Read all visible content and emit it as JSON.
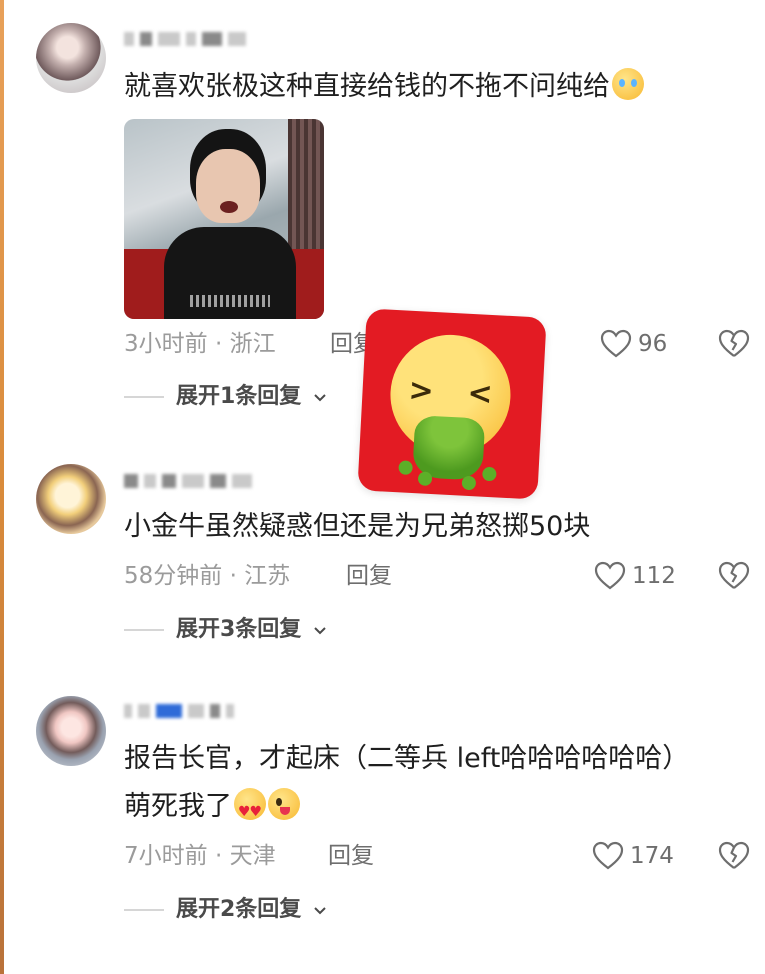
{
  "comments": [
    {
      "text": "就喜欢张极这种直接给钱的不拖不问纯给",
      "emoji": "crying-face",
      "has_photo": true,
      "meta": "3小时前 · 浙江",
      "reply_label": "回复",
      "likes": "96",
      "expand_label": "展开1条回复"
    },
    {
      "text": "小金牛虽然疑惑但还是为兄弟怒掷50块",
      "meta": "58分钟前 · 江苏",
      "reply_label": "回复",
      "likes": "112",
      "expand_label": "展开3条回复"
    },
    {
      "text_line1": "报告长官，才起床（二等兵 left哈哈哈哈哈哈）",
      "text_line2": "萌死我了",
      "emoji": [
        "heart-eyes-face",
        "winking-tongue-face"
      ],
      "meta": "7小时前 · 天津",
      "reply_label": "回复",
      "likes": "174",
      "expand_label": "展开2条回复"
    }
  ],
  "sticker": {
    "icon": "vomiting-face",
    "bg_color": "#e31b23"
  },
  "colors": {
    "meta": "#9b9b9b",
    "text": "#1f1f1f",
    "sticker_red": "#e31b23"
  }
}
